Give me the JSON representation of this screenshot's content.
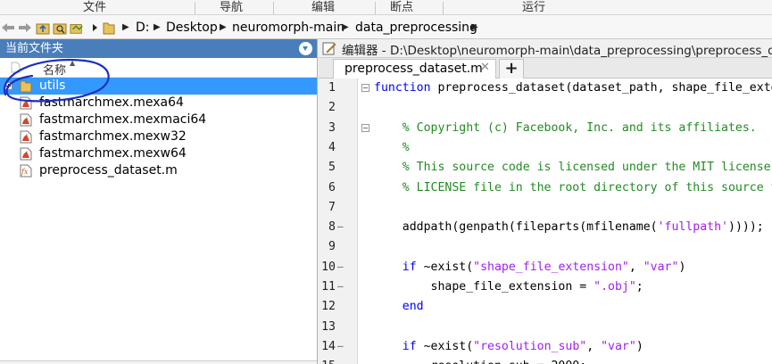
{
  "ribbon": {
    "sections": [
      "文件",
      "导航",
      "编辑",
      "断点",
      "运行"
    ]
  },
  "address_bar": {
    "crumbs": [
      "D:",
      "Desktop",
      "neuromorph-main",
      "data_preprocessing"
    ]
  },
  "current_folder": {
    "title": "当前文件夹",
    "column_name": "名称",
    "sort_indicator": "▲",
    "items": [
      {
        "name": "utils",
        "type": "folder",
        "selected": true
      },
      {
        "name": "fastmarchmex.mexa64",
        "type": "mex"
      },
      {
        "name": "fastmarchmex.mexmaci64",
        "type": "mex"
      },
      {
        "name": "fastmarchmex.mexw32",
        "type": "mex"
      },
      {
        "name": "fastmarchmex.mexw64",
        "type": "mex"
      },
      {
        "name": "preprocess_dataset.m",
        "type": "m-file"
      }
    ]
  },
  "editor": {
    "title": "编辑器 - D:\\Desktop\\neuromorph-main\\data_preprocessing\\preprocess_dataset.m",
    "tab_label": "preprocess_dataset.m",
    "tab_close": "✕",
    "add_tab": "+",
    "lines": [
      {
        "n": "1",
        "dash": "",
        "fold": true,
        "segs": [
          {
            "c": "kw",
            "t": "function"
          },
          {
            "c": "tx",
            "t": " preprocess_dataset(dataset_path, shape_file_extension, resolution_sub)"
          }
        ]
      },
      {
        "n": "2",
        "dash": "",
        "segs": []
      },
      {
        "n": "3",
        "dash": "",
        "fold": true,
        "segs": [
          {
            "c": "cm",
            "t": "    % Copyright (c) Facebook, Inc. and its affiliates."
          }
        ]
      },
      {
        "n": "4",
        "dash": "",
        "segs": [
          {
            "c": "cm",
            "t": "    %"
          }
        ]
      },
      {
        "n": "5",
        "dash": "",
        "segs": [
          {
            "c": "cm",
            "t": "    % This source code is licensed under the MIT license found in the"
          }
        ]
      },
      {
        "n": "6",
        "dash": "",
        "segs": [
          {
            "c": "cm",
            "t": "    % LICENSE file in the root directory of this source tree."
          }
        ]
      },
      {
        "n": "7",
        "dash": "",
        "segs": []
      },
      {
        "n": "8",
        "dash": "—",
        "segs": [
          {
            "c": "tx",
            "t": "    addpath(genpath(fileparts(mfilename("
          },
          {
            "c": "st",
            "t": "'fullpath'"
          },
          {
            "c": "tx",
            "t": "))));"
          }
        ]
      },
      {
        "n": "9",
        "dash": "",
        "segs": []
      },
      {
        "n": "10",
        "dash": "—",
        "segs": [
          {
            "c": "kw",
            "t": "    if"
          },
          {
            "c": "tx",
            "t": " ~exist("
          },
          {
            "c": "st",
            "t": "\"shape_file_extension\""
          },
          {
            "c": "tx",
            "t": ", "
          },
          {
            "c": "st",
            "t": "\"var\""
          },
          {
            "c": "tx",
            "t": ")"
          }
        ]
      },
      {
        "n": "11",
        "dash": "—",
        "segs": [
          {
            "c": "tx",
            "t": "        shape_file_extension = "
          },
          {
            "c": "st",
            "t": "\".obj\""
          },
          {
            "c": "tx",
            "t": ";"
          }
        ]
      },
      {
        "n": "12",
        "dash": "",
        "segs": [
          {
            "c": "kw",
            "t": "    end"
          }
        ]
      },
      {
        "n": "13",
        "dash": "",
        "segs": []
      },
      {
        "n": "14",
        "dash": "—",
        "segs": [
          {
            "c": "kw",
            "t": "    if"
          },
          {
            "c": "tx",
            "t": " ~exist("
          },
          {
            "c": "st",
            "t": "\"resolution_sub\""
          },
          {
            "c": "tx",
            "t": ", "
          },
          {
            "c": "st",
            "t": "\"var\""
          },
          {
            "c": "tx",
            "t": ")"
          }
        ]
      },
      {
        "n": "15",
        "dash": "—",
        "segs": [
          {
            "c": "tx",
            "t": "        resolution_sub = 2000;"
          }
        ]
      }
    ]
  },
  "colors": {
    "panel_header": "#4a7ebb",
    "selection": "#3399ff",
    "keyword": "#0000ff",
    "comment": "#228b22",
    "string": "#a020f0",
    "annotation": "#1a2fbf"
  }
}
